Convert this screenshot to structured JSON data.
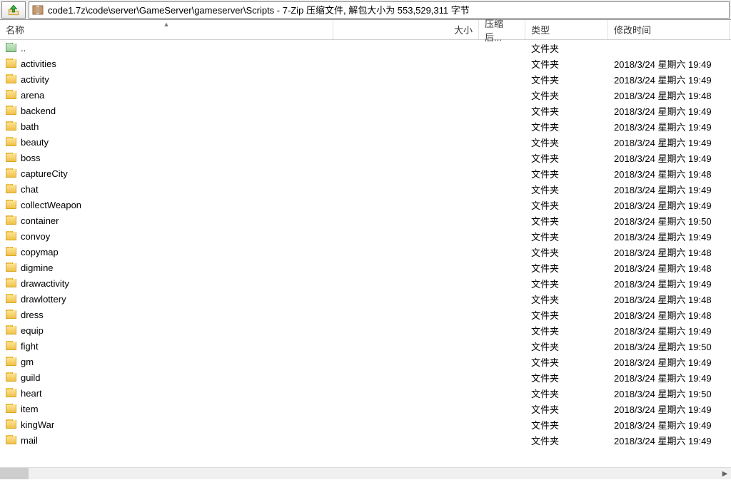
{
  "toolbar": {
    "path": "code1.7z\\code\\server\\GameServer\\gameserver\\Scripts - 7-Zip 压缩文件, 解包大小为 553,529,311 字节"
  },
  "columns": {
    "name": "名称",
    "size": "大小",
    "packed": "压缩后...",
    "type": "类型",
    "modified": "修改时间"
  },
  "parent_entry": {
    "name": "..",
    "type": "文件夹"
  },
  "entries": [
    {
      "name": "activities",
      "type": "文件夹",
      "modified": "2018/3/24 星期六 19:49"
    },
    {
      "name": "activity",
      "type": "文件夹",
      "modified": "2018/3/24 星期六 19:49"
    },
    {
      "name": "arena",
      "type": "文件夹",
      "modified": "2018/3/24 星期六 19:48"
    },
    {
      "name": "backend",
      "type": "文件夹",
      "modified": "2018/3/24 星期六 19:49"
    },
    {
      "name": "bath",
      "type": "文件夹",
      "modified": "2018/3/24 星期六 19:49"
    },
    {
      "name": "beauty",
      "type": "文件夹",
      "modified": "2018/3/24 星期六 19:49"
    },
    {
      "name": "boss",
      "type": "文件夹",
      "modified": "2018/3/24 星期六 19:49"
    },
    {
      "name": "captureCity",
      "type": "文件夹",
      "modified": "2018/3/24 星期六 19:48"
    },
    {
      "name": "chat",
      "type": "文件夹",
      "modified": "2018/3/24 星期六 19:49"
    },
    {
      "name": "collectWeapon",
      "type": "文件夹",
      "modified": "2018/3/24 星期六 19:49"
    },
    {
      "name": "container",
      "type": "文件夹",
      "modified": "2018/3/24 星期六 19:50"
    },
    {
      "name": "convoy",
      "type": "文件夹",
      "modified": "2018/3/24 星期六 19:49"
    },
    {
      "name": "copymap",
      "type": "文件夹",
      "modified": "2018/3/24 星期六 19:48"
    },
    {
      "name": "digmine",
      "type": "文件夹",
      "modified": "2018/3/24 星期六 19:48"
    },
    {
      "name": "drawactivity",
      "type": "文件夹",
      "modified": "2018/3/24 星期六 19:49"
    },
    {
      "name": "drawlottery",
      "type": "文件夹",
      "modified": "2018/3/24 星期六 19:48"
    },
    {
      "name": "dress",
      "type": "文件夹",
      "modified": "2018/3/24 星期六 19:48"
    },
    {
      "name": "equip",
      "type": "文件夹",
      "modified": "2018/3/24 星期六 19:49"
    },
    {
      "name": "fight",
      "type": "文件夹",
      "modified": "2018/3/24 星期六 19:50"
    },
    {
      "name": "gm",
      "type": "文件夹",
      "modified": "2018/3/24 星期六 19:49"
    },
    {
      "name": "guild",
      "type": "文件夹",
      "modified": "2018/3/24 星期六 19:49"
    },
    {
      "name": "heart",
      "type": "文件夹",
      "modified": "2018/3/24 星期六 19:50"
    },
    {
      "name": "item",
      "type": "文件夹",
      "modified": "2018/3/24 星期六 19:49"
    },
    {
      "name": "kingWar",
      "type": "文件夹",
      "modified": "2018/3/24 星期六 19:49"
    },
    {
      "name": "mail",
      "type": "文件夹",
      "modified": "2018/3/24 星期六 19:49"
    }
  ]
}
